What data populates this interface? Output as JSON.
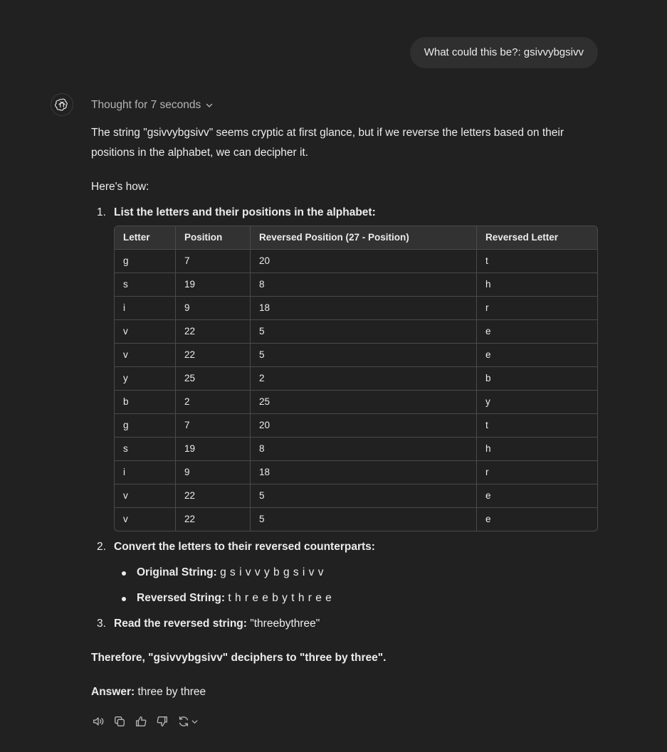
{
  "user_message": "What could this be?: gsivvybgsivv",
  "assistant": {
    "avatar_icon": "openai-logo-icon",
    "thought_label": "Thought for 7 seconds",
    "intro": "The string \"gsivvybgsivv\" seems cryptic at first glance, but if we reverse the letters based on their positions in the alphabet, we can decipher it.",
    "how": "Here's how:",
    "step1": {
      "num": "1.",
      "title": "List the letters and their positions in the alphabet:"
    },
    "table": {
      "headers": [
        "Letter",
        "Position",
        "Reversed Position (27 - Position)",
        "Reversed Letter"
      ],
      "rows": [
        [
          "g",
          "7",
          "20",
          "t"
        ],
        [
          "s",
          "19",
          "8",
          "h"
        ],
        [
          "i",
          "9",
          "18",
          "r"
        ],
        [
          "v",
          "22",
          "5",
          "e"
        ],
        [
          "v",
          "22",
          "5",
          "e"
        ],
        [
          "y",
          "25",
          "2",
          "b"
        ],
        [
          "b",
          "2",
          "25",
          "y"
        ],
        [
          "g",
          "7",
          "20",
          "t"
        ],
        [
          "s",
          "19",
          "8",
          "h"
        ],
        [
          "i",
          "9",
          "18",
          "r"
        ],
        [
          "v",
          "22",
          "5",
          "e"
        ],
        [
          "v",
          "22",
          "5",
          "e"
        ]
      ]
    },
    "step2": {
      "num": "2.",
      "title": "Convert the letters to their reversed counterparts:",
      "original_label": "Original String:",
      "original_value": "g s i v v y b g s i v v",
      "reversed_label": "Reversed String:",
      "reversed_value": "t h r e e b y t h r e e"
    },
    "step3": {
      "num": "3.",
      "title": "Read the reversed string:",
      "value": "\"threebythree\""
    },
    "therefore": "Therefore, \"gsivvybgsivv\" deciphers to \"three by three\".",
    "answer_label": "Answer:",
    "answer_value": "three by three"
  },
  "actions": [
    {
      "name": "read-aloud",
      "icon": "speaker-icon"
    },
    {
      "name": "copy",
      "icon": "copy-icon"
    },
    {
      "name": "good-response",
      "icon": "thumbs-up-icon"
    },
    {
      "name": "bad-response",
      "icon": "thumbs-down-icon"
    },
    {
      "name": "regenerate",
      "icon": "refresh-icon"
    }
  ]
}
